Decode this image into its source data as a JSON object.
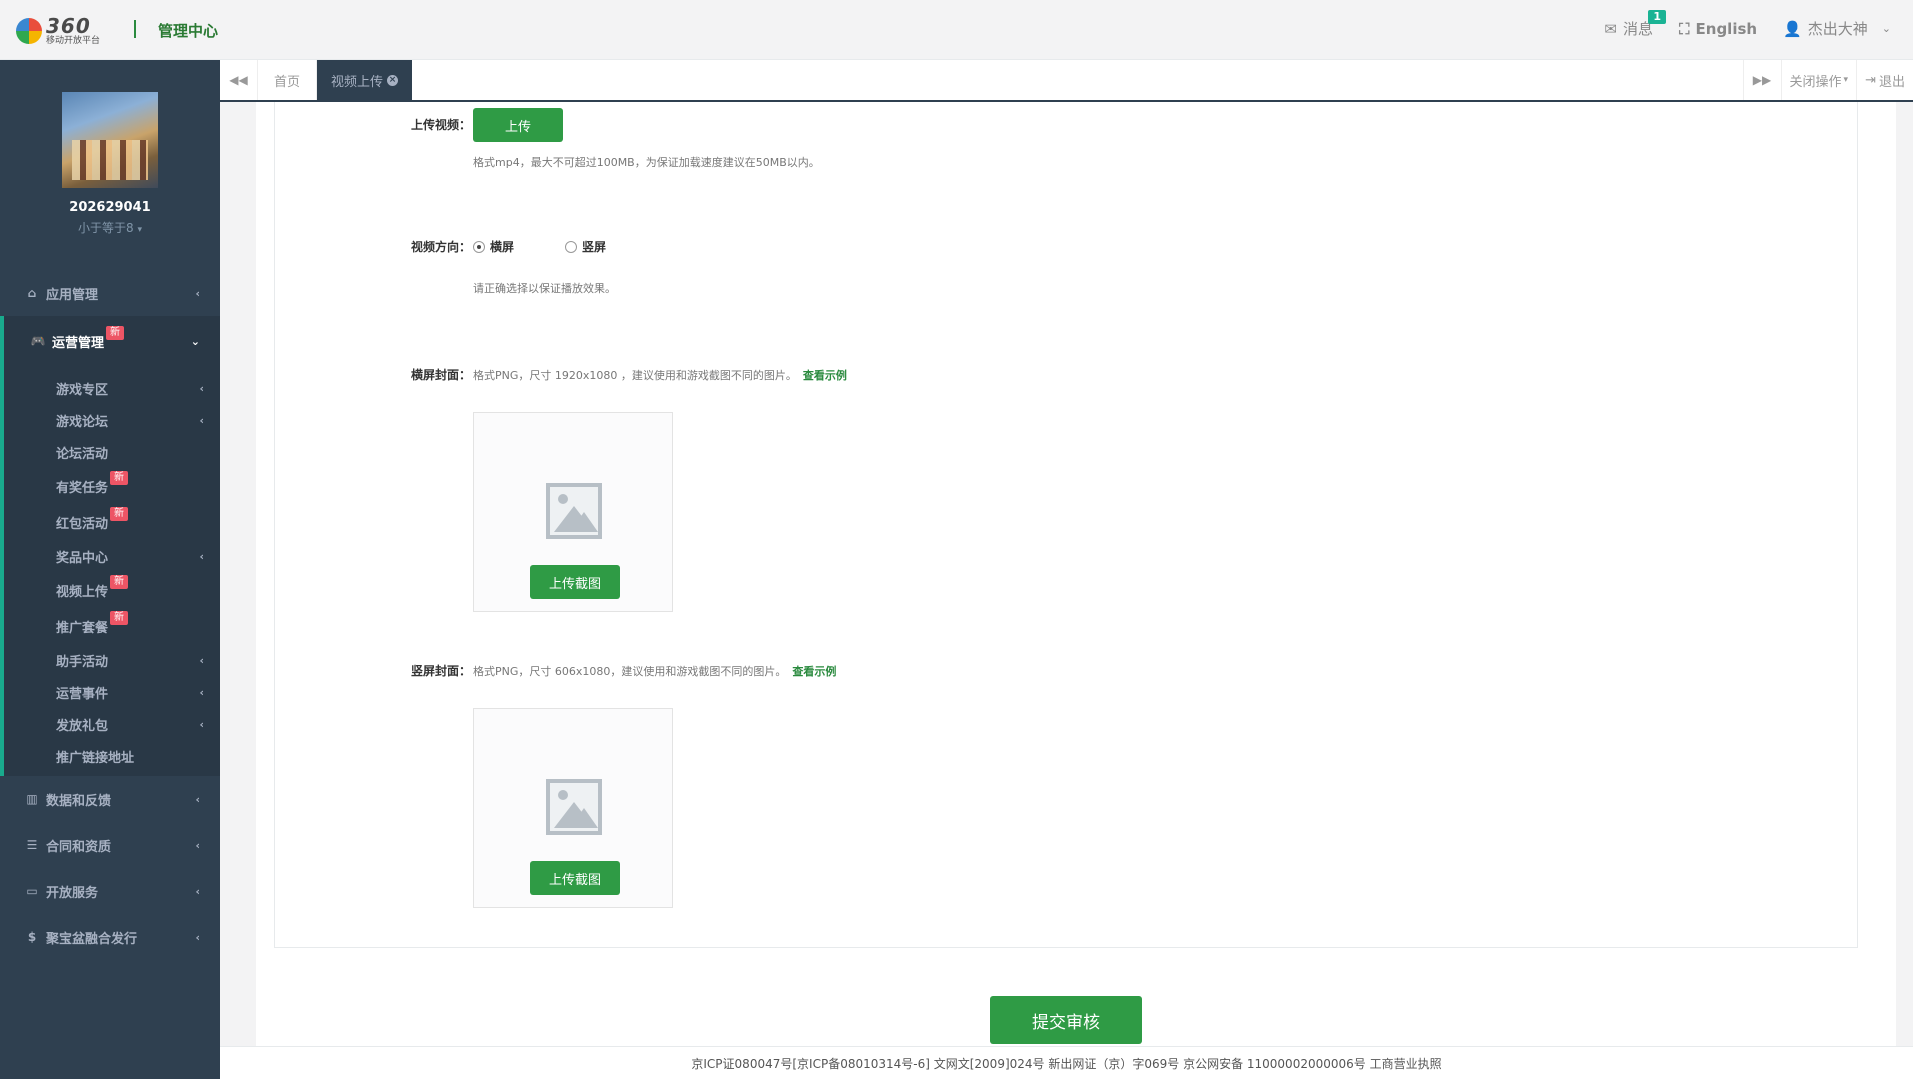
{
  "header": {
    "logo_number": "360",
    "logo_sub": "移动开放平台",
    "title": "管理中心",
    "messages_label": "消息",
    "messages_count": "1",
    "language": "English",
    "user": "杰出大神"
  },
  "profile": {
    "uid": "202629041",
    "role": "小于等于8"
  },
  "sidebar": {
    "items": [
      {
        "label": "应用管理"
      },
      {
        "label": "运营管理",
        "badge": "新"
      },
      {
        "label": "数据和反馈"
      },
      {
        "label": "合同和资质"
      },
      {
        "label": "开放服务"
      },
      {
        "label": "聚宝盆融合发行"
      }
    ],
    "sub_items": [
      {
        "label": "游戏专区"
      },
      {
        "label": "游戏论坛"
      },
      {
        "label": "论坛活动"
      },
      {
        "label": "有奖任务",
        "badge": "新"
      },
      {
        "label": "红包活动",
        "badge": "新"
      },
      {
        "label": "奖品中心"
      },
      {
        "label": "视频上传",
        "badge": "新"
      },
      {
        "label": "推广套餐",
        "badge": "新"
      },
      {
        "label": "助手活动"
      },
      {
        "label": "运营事件"
      },
      {
        "label": "发放礼包"
      },
      {
        "label": "推广链接地址"
      }
    ]
  },
  "tabs": {
    "home": "首页",
    "current": "视频上传",
    "close_ops": "关闭操作",
    "logout": "退出"
  },
  "form": {
    "upload_video_label": "上传视频：",
    "upload_btn": "上传",
    "upload_hint": "格式mp4，最大不可超过100MB，为保证加载速度建议在50MB以内。",
    "orientation_label": "视频方向：",
    "landscape": "横屏",
    "portrait": "竖屏",
    "orientation_hint": "请正确选择以保证播放效果。",
    "landscape_cover_label": "横屏封面：",
    "landscape_cover_hint": "格式PNG，尺寸 1920x1080 ，建议使用和游戏截图不同的图片。",
    "view_example": "查看示例",
    "upload_screenshot": "上传截图",
    "portrait_cover_label": "竖屏封面：",
    "portrait_cover_hint": "格式PNG，尺寸 606x1080，建议使用和游戏截图不同的图片。",
    "submit": "提交审核"
  },
  "footer": {
    "text": "京ICP证080047号[京ICP备08010314号-6] 文网文[2009]024号 新出网证（京）字069号 京公网安备 11000002000006号 工商营业执照"
  },
  "colors": {
    "sidebar_bg": "#2f4050",
    "accent_green": "#2f9b45",
    "active_border": "#19aa8d",
    "badge_red": "#ed5565"
  }
}
